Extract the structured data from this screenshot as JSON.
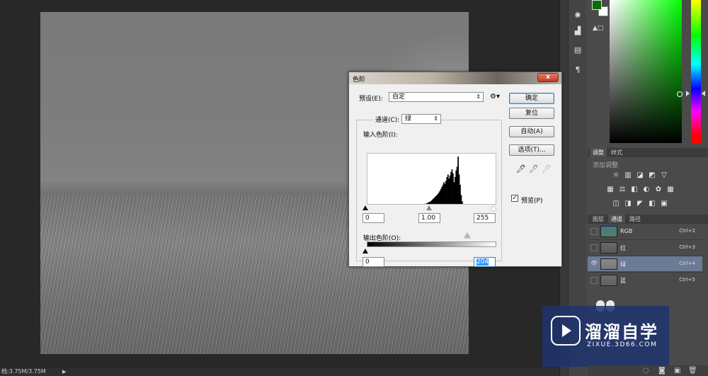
{
  "document": {
    "status_text": "档:3.75M/3.75M",
    "status_arrow": "▶"
  },
  "toolbar_dock": {
    "buttons": [
      "sun-icon",
      "levels-icon",
      "layers-icon",
      "paragraph-icon"
    ]
  },
  "color_panel": {
    "foreground": "#0a6b0a",
    "background": "#ffffff",
    "mini_controls": "▲□"
  },
  "adjustments_panel": {
    "tabs": [
      "调整",
      "样式"
    ],
    "active_tab": "调整",
    "title": "添加调整",
    "icon_rows": [
      [
        "☼",
        "▥",
        "◪",
        "◩",
        "▽"
      ],
      [
        "▦",
        "⚖",
        "◧",
        "◐",
        "✿",
        "▦"
      ],
      [
        "◫",
        "◨",
        "◤",
        "◧",
        "▣"
      ]
    ]
  },
  "channels_panel": {
    "tabs": [
      "图层",
      "通道",
      "路径"
    ],
    "active_tab": "通道",
    "channels": [
      {
        "name": "RGB",
        "shortcut": "Ctrl+2",
        "visible": false,
        "selected": false
      },
      {
        "name": "红",
        "shortcut": "Ctrl+3",
        "visible": false,
        "selected": false
      },
      {
        "name": "绿",
        "shortcut": "Ctrl+4",
        "visible": true,
        "selected": true
      },
      {
        "name": "蓝",
        "shortcut": "Ctrl+5",
        "visible": false,
        "selected": false
      }
    ],
    "bottom_icons": [
      "selection-icon",
      "mask-icon",
      "new-channel-icon",
      "trash-icon"
    ]
  },
  "watermark": {
    "title": "溜溜自学",
    "subtitle": "ZIXUE.3D66.COM"
  },
  "levels_dialog": {
    "title": "色阶",
    "close_label": "x",
    "preset_label": "预设(E):",
    "preset_value": "自定",
    "channel_label": "通道(C):",
    "channel_value": "绿",
    "input_levels_label": "输入色阶(I):",
    "input_black": "0",
    "input_gamma": "1.00",
    "input_white": "255",
    "output_levels_label": "输出色阶(O):",
    "output_black": "0",
    "output_white": "204",
    "buttons": {
      "ok": "确定",
      "reset": "复位",
      "auto": "自动(A)",
      "options": "选项(T)..."
    },
    "preview_label": "预览(P)",
    "preview_checked": true,
    "check_mark": "✓",
    "histogram": [
      0,
      0,
      0,
      0,
      0,
      0,
      0,
      0,
      0,
      0,
      0,
      0,
      0,
      0,
      0,
      0,
      0,
      0,
      0,
      0,
      0,
      0,
      0,
      0,
      0,
      0,
      0,
      0,
      0,
      0,
      0,
      0,
      0,
      0,
      0,
      0,
      0,
      0,
      0,
      0,
      0,
      0,
      0,
      0,
      0,
      0,
      0,
      0,
      0,
      0,
      0,
      1,
      1,
      1,
      2,
      2,
      3,
      3,
      4,
      5,
      6,
      7,
      8,
      10,
      12,
      14,
      16,
      18,
      20,
      22,
      25,
      28,
      32,
      36,
      40,
      45,
      42,
      48,
      55,
      60,
      52,
      58,
      65,
      70,
      62,
      45,
      55,
      68,
      75,
      95,
      60,
      40,
      20,
      8,
      3,
      1,
      0,
      0,
      0,
      0,
      0,
      0,
      0,
      0,
      0,
      0,
      0,
      0,
      0,
      0,
      0,
      0,
      0,
      0,
      0,
      0,
      0,
      0,
      0,
      0,
      0,
      0,
      0,
      0,
      0,
      0,
      0,
      0
    ]
  }
}
